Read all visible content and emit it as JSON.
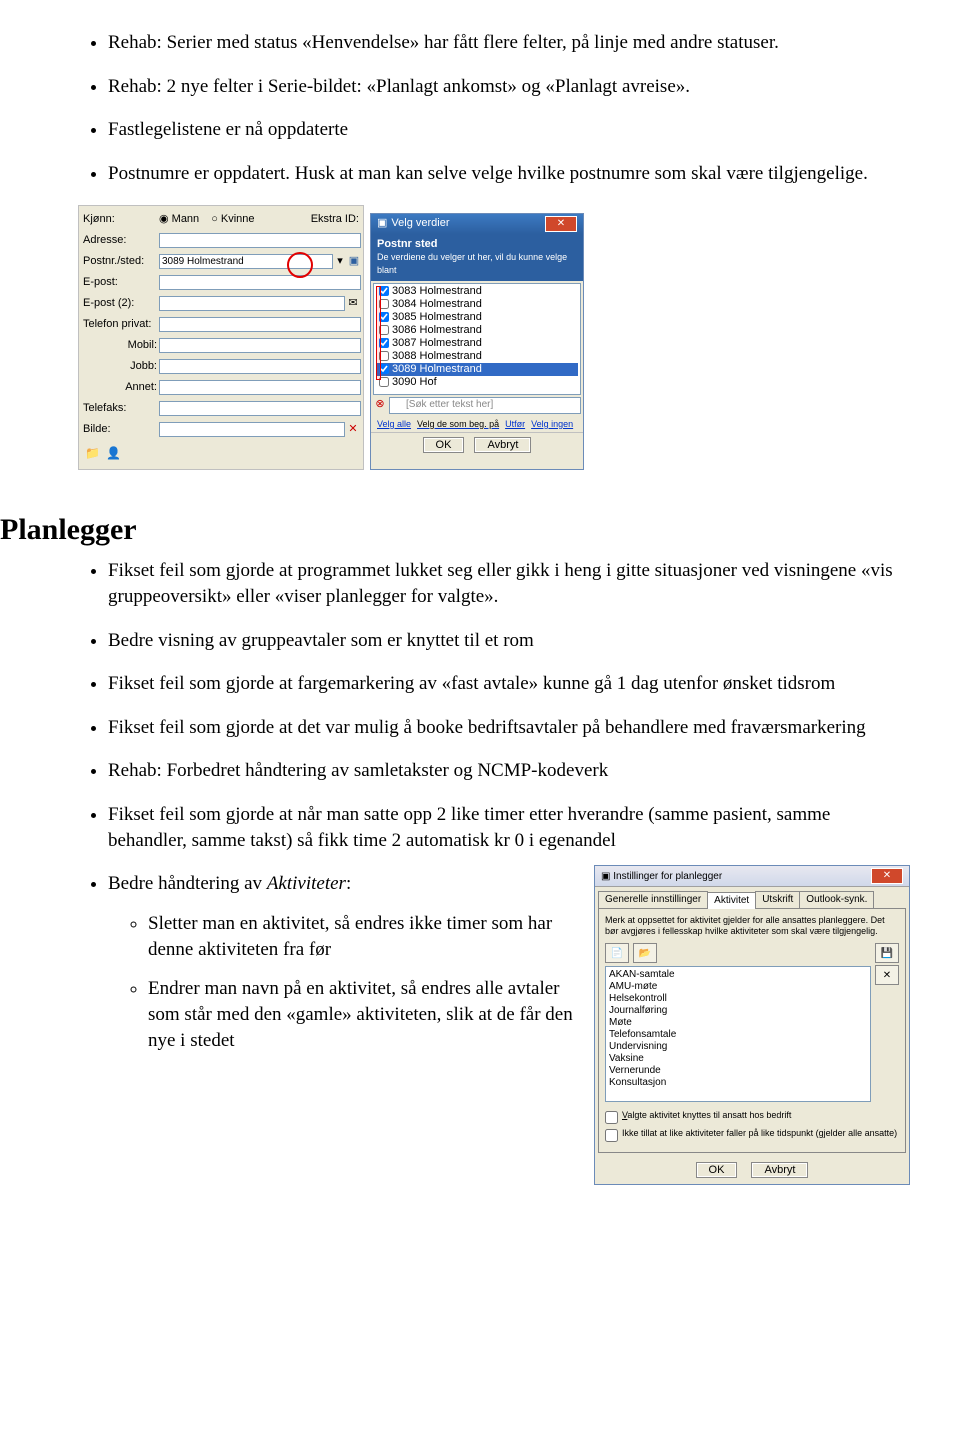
{
  "top_bullets": [
    "Rehab: Serier med status «Henvendelse» har fått flere felter, på linje med andre statuser.",
    "Rehab: 2 nye felter i Serie-bildet: «Planlagt ankomst» og «Planlagt avreise».",
    "Fastlegelistene er nå oppdaterte",
    "Postnumre er oppdatert. Husk at man kan selve velge hvilke postnumre som skal være tilgjengelige."
  ],
  "shot1": {
    "form_labels": {
      "kjonn": "Kjønn:",
      "adresse": "Adresse:",
      "postnr": "Postnr./sted:",
      "epost": "E-post:",
      "epost2": "E-post (2):",
      "tlf": "Telefon privat:",
      "mobil": "Mobil:",
      "jobb": "Jobb:",
      "annet": "Annet:",
      "telefaks": "Telefaks:",
      "bilde": "Bilde:",
      "ekstra": "Ekstra ID:"
    },
    "radio": {
      "mann": "Mann",
      "kvinne": "Kvinne"
    },
    "postnr_value": "3089 Holmestrand",
    "popup_title": "Velg verdier",
    "popup_sub_heading": "Postnr sted",
    "popup_sub_text": "De verdiene du velger ut her, vil du kunne velge blant",
    "popup_items": [
      {
        "label": "3083 Holmestrand",
        "checked": true
      },
      {
        "label": "3084 Holmestrand",
        "checked": false
      },
      {
        "label": "3085 Holmestrand",
        "checked": true
      },
      {
        "label": "3086 Holmestrand",
        "checked": false
      },
      {
        "label": "3087 Holmestrand",
        "checked": true
      },
      {
        "label": "3088 Holmestrand",
        "checked": false
      },
      {
        "label": "3089 Holmestrand",
        "checked": true,
        "selected": true
      },
      {
        "label": "3090 Hof",
        "checked": false
      }
    ],
    "search_placeholder": "[Søk etter tekst her]",
    "links": {
      "velg_alle": "Velg alle",
      "velg_beg": "Velg de som beg. på",
      "utfor": "Utfør",
      "velg_ingen": "Velg ingen"
    },
    "ok": "OK",
    "avbryt": "Avbryt"
  },
  "section_heading": "Planlegger",
  "planlegger_bullets": [
    "Fikset feil som gjorde at programmet lukket seg eller gikk i heng i gitte situasjoner ved visningene «vis gruppeoversikt» eller «viser planlegger for valgte».",
    "Bedre visning av gruppeavtaler som er knyttet til et rom",
    "Fikset feil som gjorde at fargemarkering av «fast avtale» kunne gå 1 dag utenfor ønsket tidsrom",
    "Fikset feil som gjorde at det var mulig å booke bedriftsavtaler på behandlere med fraværsmarkering",
    "Rehab: Forbedret håndtering av samletakster og NCMP-kodeverk",
    "Fikset feil som gjorde at når man satte opp 2 like timer etter hverandre (samme pasient, samme behandler, samme takst) så fikk time 2 automatisk kr 0 i egenandel"
  ],
  "aktiviteter_intro": "Bedre håndtering av ",
  "aktiviteter_em": "Aktiviteter",
  "aktiviteter_colon": ":",
  "aktiviteter_sub": [
    "Sletter man en aktivitet, så endres ikke timer som har denne aktiviteten fra før",
    "Endrer man navn på en aktivitet, så endres alle avtaler som står med den «gamle» aktiviteten, slik at de får den nye i stedet"
  ],
  "shot2": {
    "title": "Instillinger for planlegger",
    "tabs": [
      "Generelle innstillinger",
      "Aktivitet",
      "Utskrift",
      "Outlook-synk."
    ],
    "info": "Merk at oppsettet for aktivitet gjelder for alle ansattes planleggere. Det bør avgjøres i fellesskap hvilke aktiviteter som skal være tilgjengelig.",
    "items": [
      "AKAN-samtale",
      "AMU-møte",
      "Helsekontroll",
      "Journalføring",
      "Møte",
      "Telefonsamtale",
      "Undervisning",
      "Vaksine",
      "Vernerunde",
      "Konsultasjon"
    ],
    "chk1": "Valgte aktivitet knyttes til ansatt hos bedrift",
    "chk2": "Ikke tillat at like aktiviteter faller på like tidspunkt (gjelder alle ansatte)",
    "ok": "OK",
    "avbryt": "Avbryt"
  }
}
